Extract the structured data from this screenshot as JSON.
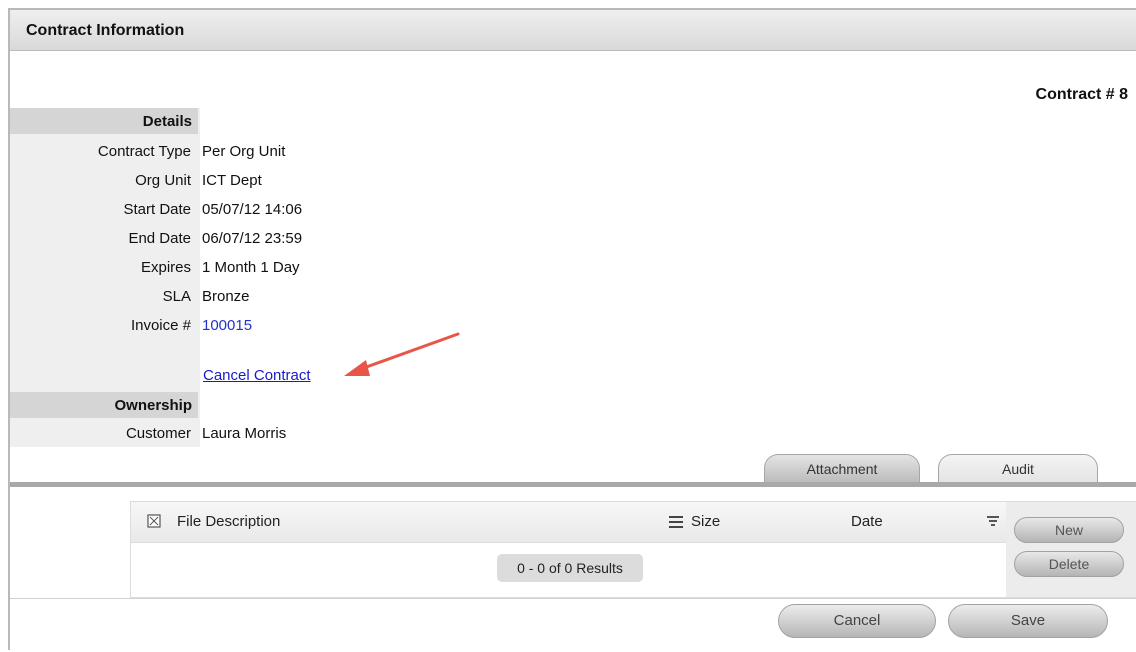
{
  "window": {
    "title": "Contract Information"
  },
  "contract": {
    "number_label": "Contract # 8"
  },
  "details": {
    "header": "Details",
    "rows": [
      {
        "label": "Contract Type",
        "value": "Per Org Unit"
      },
      {
        "label": "Org Unit",
        "value": "ICT Dept"
      },
      {
        "label": "Start Date",
        "value": "05/07/12 14:06"
      },
      {
        "label": "End Date",
        "value": "06/07/12 23:59"
      },
      {
        "label": "Expires",
        "value": "1 Month 1 Day"
      },
      {
        "label": "SLA",
        "value": "Bronze"
      },
      {
        "label": "Invoice #",
        "value": "100015"
      }
    ],
    "cancel_link": "Cancel Contract"
  },
  "ownership": {
    "header": "Ownership",
    "rows": [
      {
        "label": "Customer",
        "value": "Laura Morris"
      }
    ]
  },
  "tabs": [
    {
      "label": "Attachment"
    },
    {
      "label": "Audit"
    }
  ],
  "attachments": {
    "columns": {
      "description": "File Description",
      "size": "Size",
      "date": "Date"
    },
    "results": "0 - 0 of 0 Results",
    "new_button": "New",
    "delete_button": "Delete"
  },
  "footer": {
    "cancel": "Cancel",
    "save": "Save"
  },
  "colors": {
    "link": "#1a1acc",
    "annotation_arrow": "#e8564a"
  }
}
